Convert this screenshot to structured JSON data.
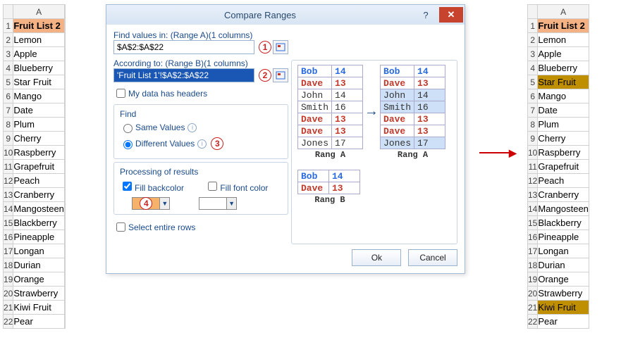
{
  "left_grid": {
    "col_label": "A",
    "header": "Fruit  List 2",
    "rows": [
      "Lemon",
      "Apple",
      "Blueberry",
      "Star Fruit",
      "Mango",
      "Date",
      "Plum",
      "Cherry",
      "Raspberry",
      "Grapefruit",
      "Peach",
      "Cranberry",
      "Mangosteen",
      "Blackberry",
      "Pineapple",
      "Longan",
      "Durian",
      "Orange",
      "Strawberry",
      "Kiwi Fruit",
      "Pear"
    ]
  },
  "right_grid": {
    "col_label": "A",
    "header": "Fruit  List 2",
    "rows": [
      "Lemon",
      "Apple",
      "Blueberry",
      "Star Fruit",
      "Mango",
      "Date",
      "Plum",
      "Cherry",
      "Raspberry",
      "Grapefruit",
      "Peach",
      "Cranberry",
      "Mangosteen",
      "Blackberry",
      "Pineapple",
      "Longan",
      "Durian",
      "Orange",
      "Strawberry",
      "Kiwi Fruit",
      "Pear"
    ],
    "highlighted_rows": [
      5,
      21
    ]
  },
  "dialog": {
    "title": "Compare Ranges",
    "findvalues_lbl": "Find values in: (Range A)(1 columns)",
    "rangeA": "$A$2:$A$22",
    "according_lbl": "According to: (Range B)(1 columns)",
    "rangeB": "'Fruit List 1'!$A$2:$A$22",
    "my_headers": "My data has headers",
    "find_lbl": "Find",
    "same_values": "Same Values",
    "diff_values": "Different Values",
    "proc_lbl": "Processing of results",
    "fill_back": "Fill backcolor",
    "fill_font": "Fill font color",
    "select_rows": "Select entire rows",
    "ok": "Ok",
    "cancel": "Cancel",
    "bubbles": {
      "one": "1",
      "two": "2",
      "three": "3",
      "four": "4"
    }
  },
  "preview": {
    "rangA_lbl": "Rang A",
    "rangB_lbl": "Rang B",
    "tableA": [
      {
        "n": "Bob",
        "v": "14",
        "cls": "blue"
      },
      {
        "n": "Dave",
        "v": "13",
        "cls": "red"
      },
      {
        "n": "John",
        "v": "14",
        "cls": "plain"
      },
      {
        "n": "Smith",
        "v": "16",
        "cls": "plain"
      },
      {
        "n": "Dave",
        "v": "13",
        "cls": "red"
      },
      {
        "n": "Dave",
        "v": "13",
        "cls": "red"
      },
      {
        "n": "Jones",
        "v": "17",
        "cls": "plain"
      }
    ],
    "tableA_sel": [
      {
        "n": "Bob",
        "v": "14",
        "cls": "blue",
        "s": false
      },
      {
        "n": "Dave",
        "v": "13",
        "cls": "red",
        "s": false
      },
      {
        "n": "John",
        "v": "14",
        "cls": "plain",
        "s": true
      },
      {
        "n": "Smith",
        "v": "16",
        "cls": "plain",
        "s": true
      },
      {
        "n": "Dave",
        "v": "13",
        "cls": "red",
        "s": false
      },
      {
        "n": "Dave",
        "v": "13",
        "cls": "red",
        "s": false
      },
      {
        "n": "Jones",
        "v": "17",
        "cls": "plain",
        "s": true
      }
    ],
    "tableB": [
      {
        "n": "Bob",
        "v": "14",
        "cls": "blue"
      },
      {
        "n": "Dave",
        "v": "13",
        "cls": "red"
      }
    ]
  }
}
